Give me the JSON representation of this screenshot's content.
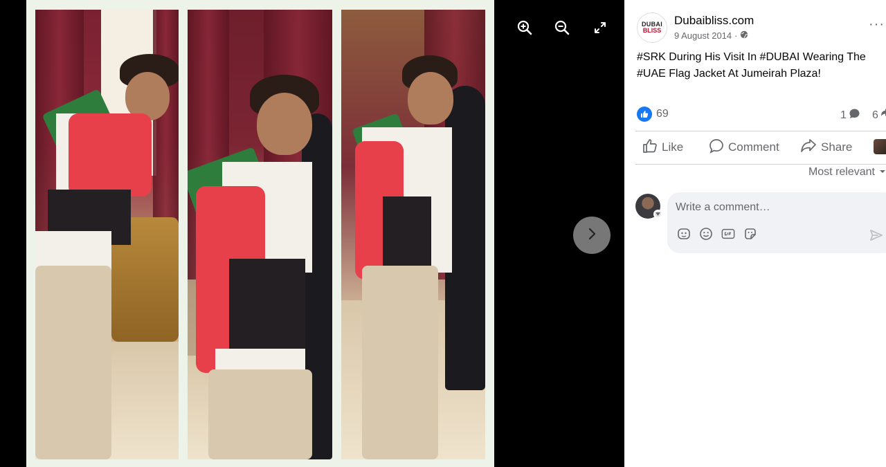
{
  "viewer": {
    "icons": [
      "zoom-in-icon",
      "zoom-out-icon",
      "fullscreen-icon",
      "chevron-right-icon"
    ]
  },
  "post": {
    "page_name": "Dubaibliss.com",
    "logo": {
      "line1": "DUBAI",
      "line2": "BLISS"
    },
    "date": "9 August 2014",
    "separator": "·",
    "more_label": "···",
    "caption": {
      "part1": "#SRK",
      "part2": " During His Visit In ",
      "part3": "#DUBAI",
      "part4": " Wearing The ",
      "part5": "#UAE",
      "part6": " Flag Jacket At Jumeirah Plaza!"
    },
    "reactions": {
      "likes": "69",
      "comments": "1",
      "shares": "6"
    },
    "actions": {
      "like": "Like",
      "comment": "Comment",
      "share": "Share"
    },
    "sort_label": "Most relevant",
    "comment_placeholder": "Write a comment…"
  },
  "colors": {
    "facebook_blue": "#1877f2",
    "text_primary": "#050505",
    "text_secondary": "#65676b",
    "input_bg": "#f0f2f5"
  }
}
